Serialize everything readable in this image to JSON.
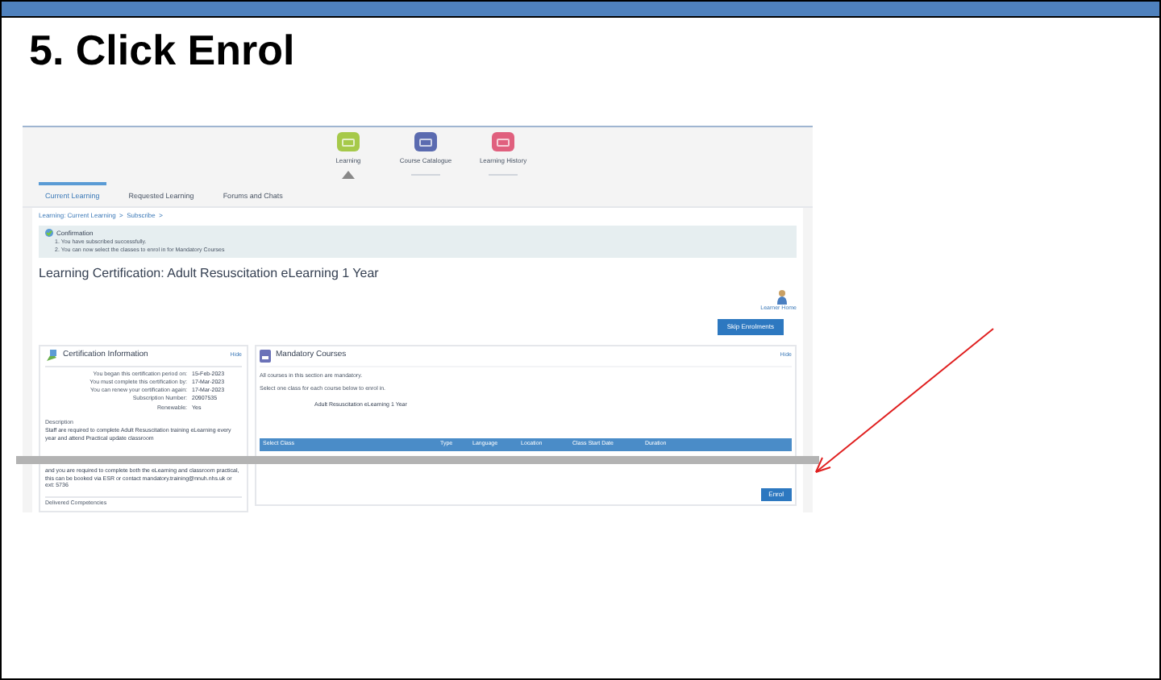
{
  "slide": {
    "title": "5. Click Enrol"
  },
  "screenshot": {
    "nav_icons": [
      {
        "label": "Learning",
        "color": "#a6c94a",
        "selected": true
      },
      {
        "label": "Course Catalogue",
        "color": "#5b6bb0",
        "selected": false
      },
      {
        "label": "Learning History",
        "color": "#e0607e",
        "selected": false
      }
    ],
    "tabs": [
      {
        "label": "Current Learning",
        "selected": true
      },
      {
        "label": "Requested Learning",
        "selected": false
      },
      {
        "label": "Forums and Chats",
        "selected": false
      }
    ],
    "breadcrumb": "Learning: Current Learning  >  Subscribe  >",
    "confirmation": {
      "title": "Confirmation",
      "lines": [
        "1. You have subscribed successfully.",
        "2. You can now select the classes to enrol in for Mandatory Courses"
      ]
    },
    "page_title": "Learning Certification: Adult Resuscitation eLearning 1 Year",
    "learner_home": "Learner Home",
    "skip_button": "Skip Enrolments",
    "certification": {
      "title": "Certification Information",
      "hide": "Hide",
      "rows": [
        {
          "label": "You began this certification period on:",
          "value": "15-Feb-2023"
        },
        {
          "label": "You must complete this certification by:",
          "value": "17-Mar-2023"
        },
        {
          "label": "You can renew your certification again:",
          "value": "17-Mar-2023"
        },
        {
          "label": "Subscription Number:",
          "value": "20907535"
        },
        {
          "label": "Renewable:",
          "value": "Yes"
        }
      ],
      "description_label": "Description",
      "description": "Staff are required to complete Adult Resuscitation training eLearning every year and attend Practical update classroom",
      "description_more": "and you are required to complete both the eLearning and classroom practical, this can be booked via ESR or contact mandatory.training@nnuh.nhs.uk or ext: 5736",
      "delivered": "Delivered Competencies"
    },
    "mandatory": {
      "title": "Mandatory Courses",
      "hide": "Hide",
      "lines": [
        "All courses in this section are mandatory.",
        "Select one class for each course below to enrol in."
      ],
      "course": "Adult Resuscitation eLearning 1 Year",
      "columns": [
        "Select Class",
        "Type",
        "Language",
        "Location",
        "Class Start Date",
        "Duration"
      ],
      "enrol_button": "Enrol"
    }
  }
}
